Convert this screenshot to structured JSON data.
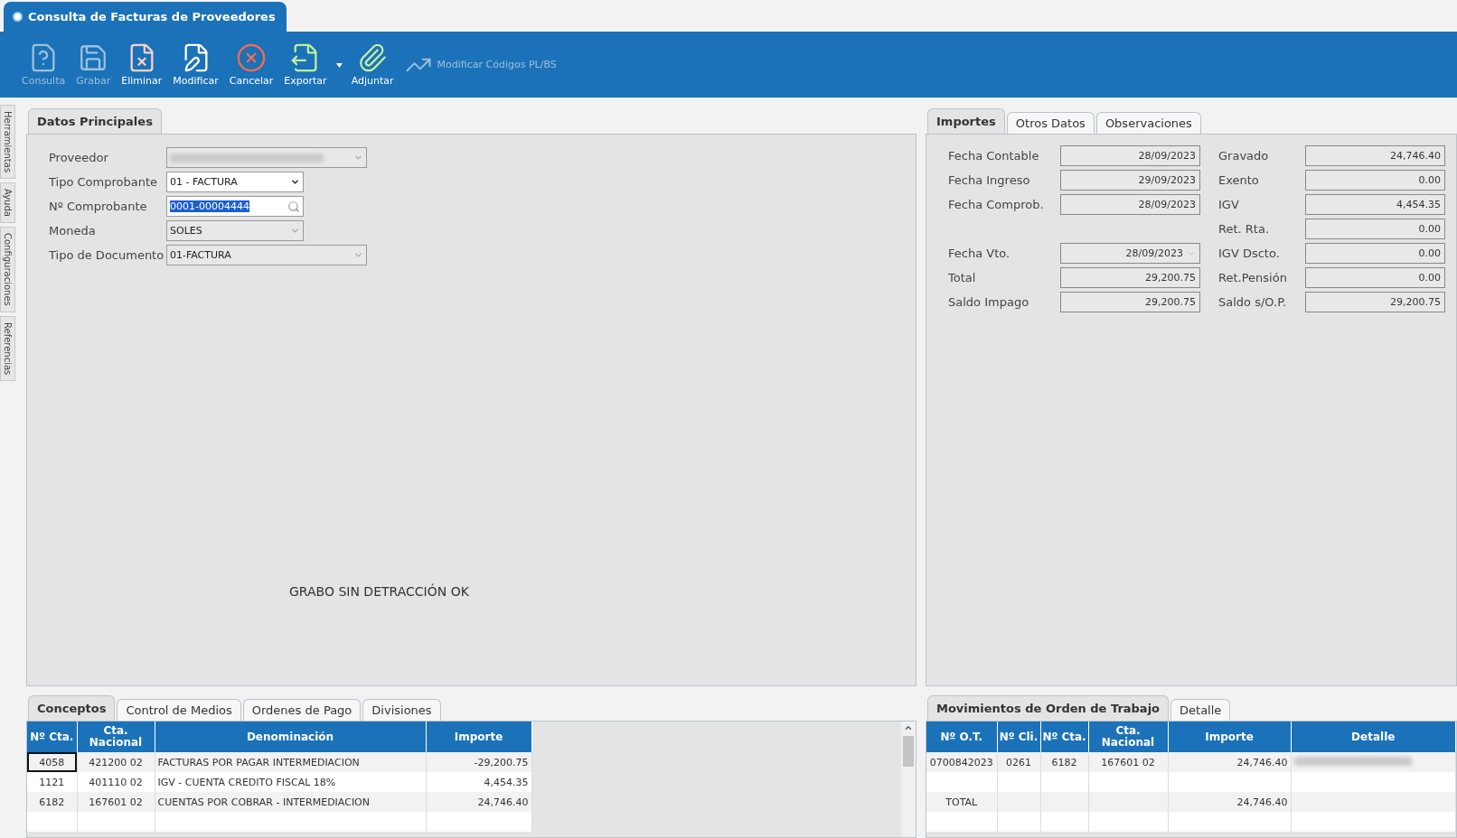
{
  "window": {
    "title": "Consulta de Facturas de Proveedores"
  },
  "toolbar": [
    {
      "label": "Consulta",
      "kind": "large",
      "disabled": true
    },
    {
      "label": "Grabar",
      "kind": "large",
      "disabled": true
    },
    {
      "label": "Eliminar",
      "kind": "large",
      "disabled": false
    },
    {
      "label": "Modificar",
      "kind": "large",
      "disabled": false
    },
    {
      "label": "Cancelar",
      "kind": "large",
      "disabled": false
    },
    {
      "label": "Exportar",
      "kind": "large",
      "disabled": false,
      "dropdown": true
    },
    {
      "label": "Adjuntar",
      "kind": "large",
      "disabled": false
    },
    {
      "label": "Modificar Códigos PL/BS",
      "kind": "inline",
      "disabled": true
    }
  ],
  "side_tabs": [
    "Herramientas",
    "Ayuda",
    "Configuraciones",
    "Referencias"
  ],
  "main_tabs": [
    {
      "label": "Datos Principales",
      "selected": true
    }
  ],
  "main_fields": [
    {
      "label": "Proveedor",
      "kind": "select",
      "disabled": true,
      "wide": true,
      "redacted": true
    },
    {
      "label": "Tipo Comprobante",
      "kind": "select",
      "disabled": false,
      "value": "01 - FACTURA"
    },
    {
      "label": "Nº Comprobante",
      "kind": "search",
      "disabled": false,
      "value": "0001-00004444",
      "highlighted": true
    },
    {
      "label": "Moneda",
      "kind": "select",
      "disabled": true,
      "value": "SOLES"
    },
    {
      "label": "Tipo de Documento",
      "kind": "select",
      "disabled": true,
      "wide": true,
      "value": "01-FACTURA"
    }
  ],
  "message": "GRABO SIN DETRACCIÓN OK",
  "amount_tabs": [
    {
      "label": "Importes",
      "selected": true
    },
    {
      "label": "Otros Datos",
      "selected": false
    },
    {
      "label": "Observaciones",
      "selected": false
    }
  ],
  "amounts_left": [
    {
      "fields": [
        {
          "label": "Fecha Contable",
          "value": "28/09/2023",
          "kind": "text"
        },
        {
          "label": "Fecha Ingreso",
          "value": "29/09/2023",
          "kind": "text"
        },
        {
          "label": "Fecha Comprob.",
          "value": "28/09/2023",
          "kind": "text"
        }
      ]
    },
    {
      "fields": [
        {
          "label": "Fecha Vto.",
          "value": "28/09/2023",
          "kind": "date"
        },
        {
          "label": "Total",
          "value": "29,200.75",
          "kind": "text"
        },
        {
          "label": "Saldo Impago",
          "value": "29,200.75",
          "kind": "text"
        }
      ]
    }
  ],
  "amounts_right": [
    {
      "label": "Gravado",
      "value": "24,746.40"
    },
    {
      "label": "Exento",
      "value": "0.00"
    },
    {
      "label": "IGV",
      "value": "4,454.35"
    },
    {
      "label": "Ret. Rta.",
      "value": "0.00"
    },
    {
      "label": "IGV Dscto.",
      "value": "0.00"
    },
    {
      "label": "Ret.Pensión",
      "value": "0.00"
    },
    {
      "label": "Saldo s/O.P.",
      "value": "29,200.75"
    }
  ],
  "concept_tabs": [
    {
      "label": "Conceptos",
      "selected": true
    },
    {
      "label": "Control de Medios",
      "selected": false
    },
    {
      "label": "Ordenes de Pago",
      "selected": false
    },
    {
      "label": "Divisiones",
      "selected": false
    }
  ],
  "concepts_table": {
    "columns": [
      "Nº Cta.",
      "Cta. Nacional",
      "Denominación",
      "Importe"
    ],
    "rows": [
      {
        "cells": [
          "4058",
          "421200 02",
          "FACTURAS POR PAGAR INTERMEDIACION",
          "-29,200.75"
        ],
        "focused": true
      },
      {
        "cells": [
          "1121",
          "401110 02",
          "IGV - CUENTA CREDITO FISCAL 18%",
          "4,454.35"
        ],
        "focused": false
      },
      {
        "cells": [
          "6182",
          "167601 02",
          "CUENTAS POR COBRAR - INTERMEDIACION",
          "24,746.40"
        ],
        "focused": false
      }
    ]
  },
  "movement_tabs": [
    {
      "label": "Movimientos de Orden de Trabajo",
      "selected": true
    },
    {
      "label": "Detalle",
      "selected": false
    }
  ],
  "movements_table": {
    "columns": [
      "Nº O.T.",
      "Nº Cli.",
      "Nº Cta.",
      "Cta. Nacional",
      "Importe",
      "Detalle"
    ],
    "rows": [
      {
        "cells": [
          "0700842023",
          "0261",
          "6182",
          "167601 02",
          "24,746.40"
        ],
        "redacted_detail": true
      },
      {
        "cells": []
      },
      {
        "cells": [
          "TOTAL",
          "",
          "",
          "",
          "24,746.40"
        ],
        "redacted_detail": false
      }
    ]
  }
}
